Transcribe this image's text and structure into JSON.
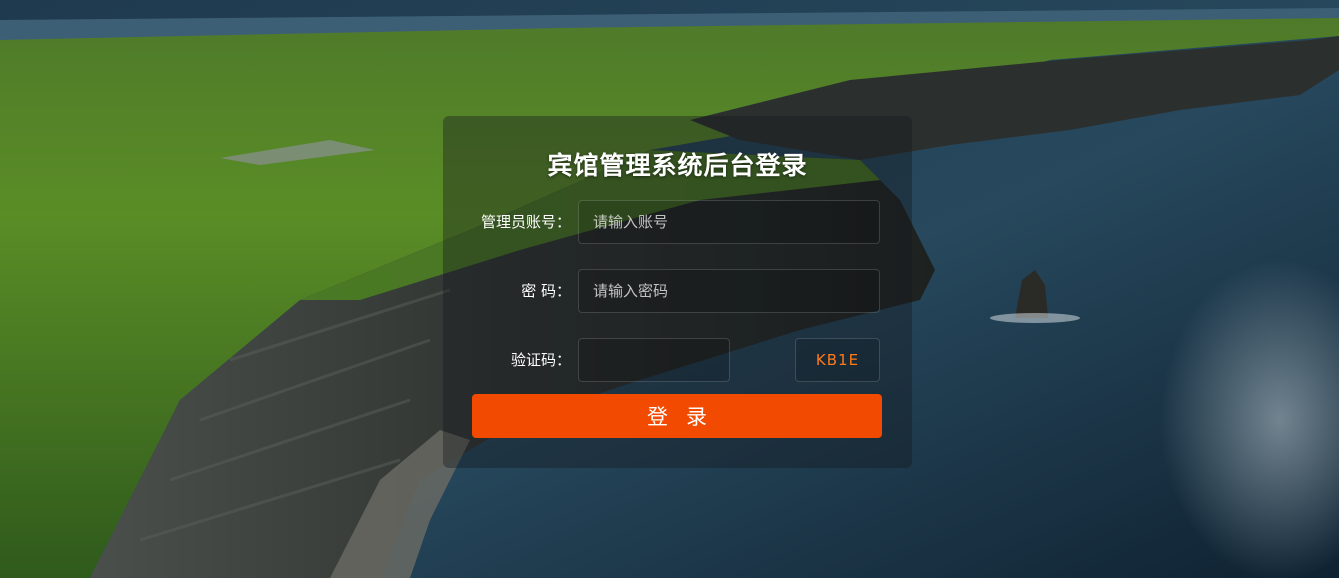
{
  "page": {
    "title": "宾馆管理系统后台登录"
  },
  "login_form": {
    "username": {
      "label": "管理员账号：",
      "placeholder": "请输入账号",
      "value": ""
    },
    "password": {
      "label": "密 码：",
      "placeholder": "请输入密码",
      "value": ""
    },
    "captcha": {
      "label": "验证码：",
      "value": "",
      "code": "KB1E"
    },
    "submit_label": "登录"
  },
  "colors": {
    "accent": "#f24a00",
    "captcha_text": "#ff7a1a",
    "panel_overlay": "rgba(20,24,28,0.38)"
  },
  "background": {
    "icon": "coastal-cliffs-landscape"
  }
}
